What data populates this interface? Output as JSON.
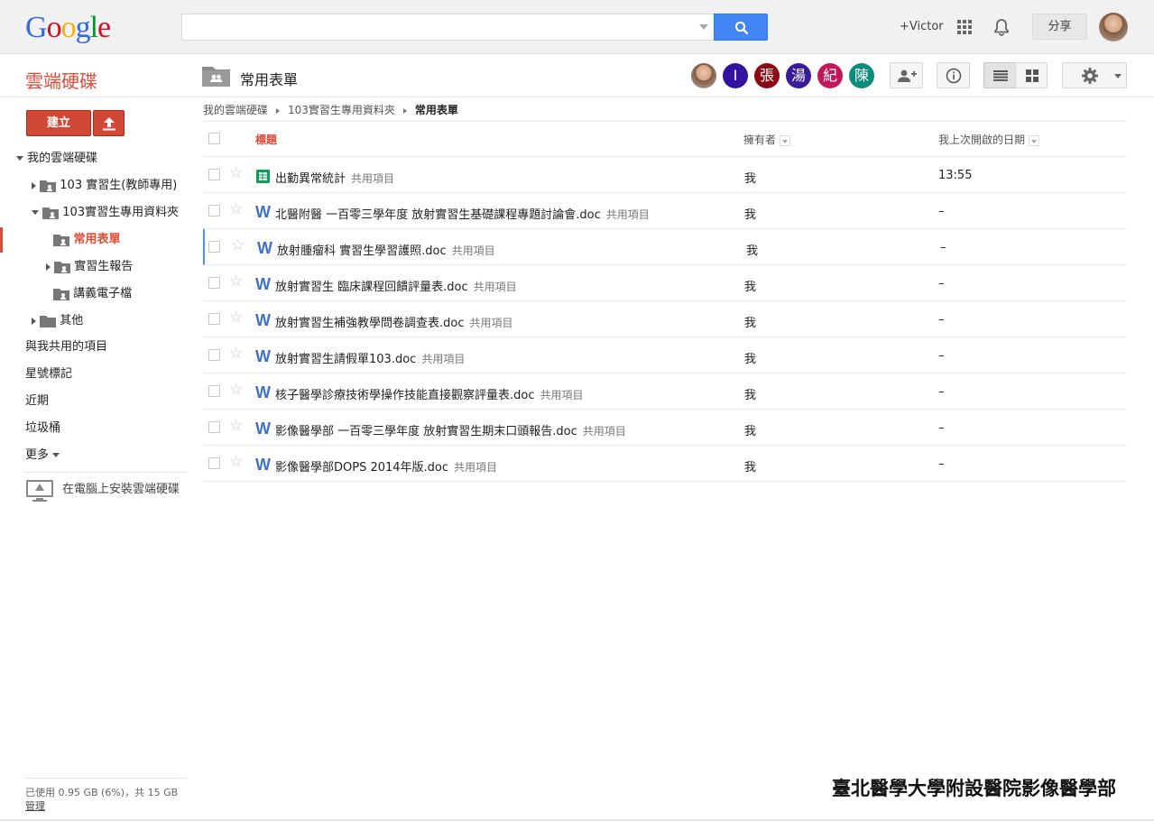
{
  "header": {
    "logo_letters": [
      "G",
      "o",
      "o",
      "g",
      "l",
      "e"
    ],
    "logo_colors": [
      "#3369e8",
      "#d50f25",
      "#eeb211",
      "#3369e8",
      "#009925",
      "#d50f25"
    ],
    "search_placeholder": "",
    "user_label": "+Victor",
    "share_label": "分享"
  },
  "subheader": {
    "app_title": "雲端硬碟",
    "folder_title": "常用表單",
    "shared_avatars": [
      {
        "letter": "",
        "color": "#b08a70",
        "is_photo": true
      },
      {
        "letter": "I",
        "color": "#3412a0"
      },
      {
        "letter": "張",
        "color": "#8b0a14"
      },
      {
        "letter": "湯",
        "color": "#3a1c9a"
      },
      {
        "letter": "紀",
        "color": "#c2185b"
      },
      {
        "letter": "陳",
        "color": "#0b8c7c"
      }
    ]
  },
  "sidebar": {
    "create_label": "建立",
    "items": [
      {
        "label": "我的雲端硬碟"
      },
      {
        "label": "103 實習生(教師專用)"
      },
      {
        "label": "103實習生專用資料夾"
      },
      {
        "label": "常用表單"
      },
      {
        "label": "實習生報告"
      },
      {
        "label": "講義電子檔"
      },
      {
        "label": "其他"
      },
      {
        "label": "與我共用的項目"
      },
      {
        "label": "星號標記"
      },
      {
        "label": "近期"
      },
      {
        "label": "垃圾桶"
      },
      {
        "label": "更多"
      }
    ],
    "install_label": "在電腦上安裝雲端硬碟",
    "storage_text": "已使用 0.95 GB (6%)，共 15 GB",
    "manage_label": "管理"
  },
  "breadcrumb": [
    "我的雲端硬碟",
    "103實習生專用資料夾",
    "常用表單"
  ],
  "table": {
    "headers": {
      "title": "標題",
      "owner": "擁有者",
      "last_opened": "我上次開啟的日期"
    },
    "shared_tag": "共用項目",
    "rows": [
      {
        "name": "出勤異常統計",
        "type": "sheet",
        "owner": "我",
        "date": "13:55"
      },
      {
        "name": "北醫附醫 一百零三學年度 放射實習生基礎課程專題討論會.doc",
        "type": "word",
        "owner": "我",
        "date": "–"
      },
      {
        "name": "放射腫瘤科 實習生學習護照.doc",
        "type": "word",
        "owner": "我",
        "date": "–"
      },
      {
        "name": "放射實習生 臨床課程回饋評量表.doc",
        "type": "word",
        "owner": "我",
        "date": "–"
      },
      {
        "name": "放射實習生補強教學問卷調查表.doc",
        "type": "word",
        "owner": "我",
        "date": "–"
      },
      {
        "name": "放射實習生請假單103.doc",
        "type": "word",
        "owner": "我",
        "date": "–"
      },
      {
        "name": "核子醫學診療技術學操作技能直接觀察評量表.doc",
        "type": "word",
        "owner": "我",
        "date": "–"
      },
      {
        "name": "影像醫學部 一百零三學年度 放射實習生期末口頭報告.doc",
        "type": "word",
        "owner": "我",
        "date": "–"
      },
      {
        "name": "影像醫學部DOPS 2014年版.doc",
        "type": "word",
        "owner": "我",
        "date": "–"
      }
    ]
  },
  "footer": {
    "org_text": "臺北醫學大學附設醫院影像醫學部"
  },
  "colors": {
    "accent": "#dd4b39",
    "search_blue": "#4285f4",
    "word_blue": "#3f70c6",
    "sheet_green": "#0f9d58"
  }
}
